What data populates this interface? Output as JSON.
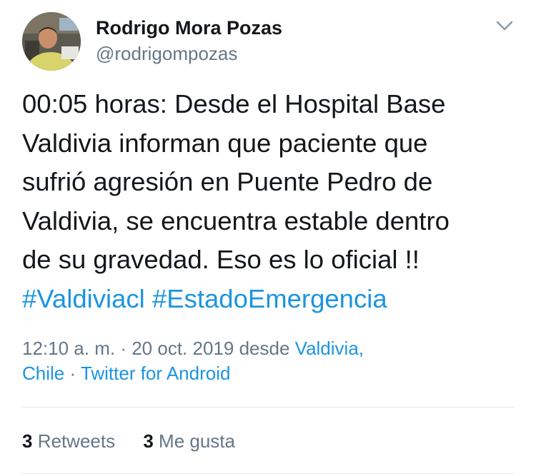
{
  "author": {
    "display_name": "Rodrigo Mora Pozas",
    "handle": "@rodrigompozas"
  },
  "tweet": {
    "text_lines": [
      "00:05 horas: Desde el Hospital Base",
      "Valdivia informan que paciente que",
      "sufrió agresión en Puente Pedro de",
      "Valdivia, se encuentra estable dentro",
      "de su gravedad. Eso es lo oficial !!"
    ],
    "hashtags": [
      "#Valdiviacl",
      "#EstadoEmergencia"
    ]
  },
  "meta": {
    "time": "12:10 a. m.",
    "separator": "·",
    "date": "20 oct. 2019",
    "from_label": "desde",
    "location_part1": "Valdivia,",
    "location_part2": "Chile",
    "source": "Twitter for Android"
  },
  "stats": {
    "retweets_count": "3",
    "retweets_label": "Retweets",
    "likes_count": "3",
    "likes_label": "Me gusta"
  },
  "colors": {
    "link": "#1b95e0",
    "secondary_text": "#657786",
    "primary_text": "#14171a",
    "divider": "#e1e8ed"
  },
  "icons": {
    "menu": "chevron-down-icon"
  }
}
